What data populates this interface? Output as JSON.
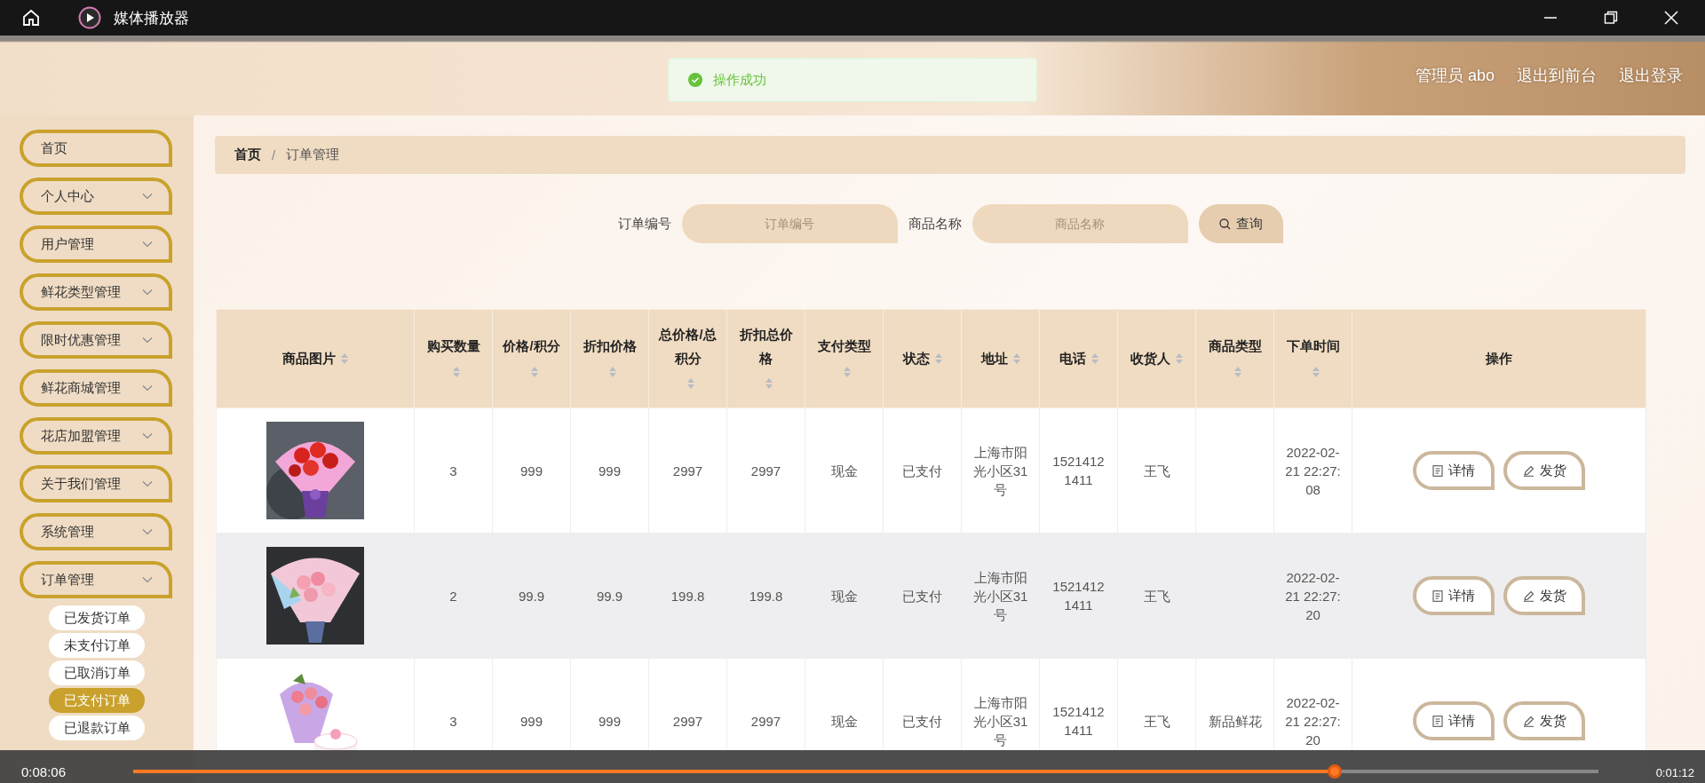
{
  "player": {
    "title": "媒体播放器",
    "elapsed": "0:08:06",
    "remaining": "0:01:12",
    "level": 0.82
  },
  "header": {
    "links": [
      "管理员 abo",
      "退出到前台",
      "退出登录"
    ]
  },
  "toast": {
    "text": "操作成功"
  },
  "sidebar": {
    "items": [
      {
        "label": "首页",
        "kind": "link"
      },
      {
        "label": "个人中心",
        "kind": "submenu"
      },
      {
        "label": "用户管理",
        "kind": "submenu"
      },
      {
        "label": "鲜花类型管理",
        "kind": "submenu"
      },
      {
        "label": "限时优惠管理",
        "kind": "submenu"
      },
      {
        "label": "鲜花商城管理",
        "kind": "submenu"
      },
      {
        "label": "花店加盟管理",
        "kind": "submenu"
      },
      {
        "label": "关于我们管理",
        "kind": "submenu"
      },
      {
        "label": "系统管理",
        "kind": "submenu"
      },
      {
        "label": "订单管理",
        "kind": "submenu",
        "children": [
          {
            "label": "已发货订单",
            "selected": false
          },
          {
            "label": "未支付订单",
            "selected": false
          },
          {
            "label": "已取消订单",
            "selected": false
          },
          {
            "label": "已支付订单",
            "selected": true
          },
          {
            "label": "已退款订单",
            "selected": false
          }
        ]
      }
    ]
  },
  "breadcrumb": {
    "items": [
      "首页",
      "订单管理"
    ],
    "separator": "/"
  },
  "search": {
    "fields": [
      {
        "label": "订单编号",
        "placeholder": "订单编号"
      },
      {
        "label": "商品名称",
        "placeholder": "商品名称"
      }
    ],
    "button": "查询"
  },
  "table": {
    "columns": [
      {
        "label": "商品图片",
        "sortable": true
      },
      {
        "label": "购买数量",
        "sortable": true
      },
      {
        "label": "价格/积分",
        "sortable": true
      },
      {
        "label": "折扣价格",
        "sortable": true
      },
      {
        "label": "总价格/总积分",
        "sortable": true
      },
      {
        "label": "折扣总价格",
        "sortable": true
      },
      {
        "label": "支付类型",
        "sortable": true
      },
      {
        "label": "状态",
        "sortable": true
      },
      {
        "label": "地址",
        "sortable": true
      },
      {
        "label": "电话",
        "sortable": true
      },
      {
        "label": "收货人",
        "sortable": true
      },
      {
        "label": "商品类型",
        "sortable": true
      },
      {
        "label": "下单时间",
        "sortable": true
      },
      {
        "label": "操作",
        "sortable": false
      }
    ],
    "rows": [
      {
        "highlighted": false,
        "cells": [
          {
            "kind": "picture"
          },
          "3",
          "999",
          "999",
          "2997",
          "2997",
          "现金",
          "已支付",
          "上海市阳光小区31号",
          "15214121411",
          "王飞",
          "",
          "2022-02-21 22:27:08",
          {
            "kind": "actions",
            "buttons": [
              "详情",
              "发货"
            ]
          }
        ]
      },
      {
        "highlighted": true,
        "cells": [
          {
            "kind": "picture"
          },
          "2",
          "99.9",
          "99.9",
          "199.8",
          "199.8",
          "现金",
          "已支付",
          "上海市阳光小区31号",
          "15214121411",
          "王飞",
          "",
          "2022-02-21 22:27:20",
          {
            "kind": "actions",
            "buttons": [
              "详情",
              "发货"
            ]
          }
        ]
      },
      {
        "highlighted": false,
        "cells": [
          {
            "kind": "picture"
          },
          "3",
          "999",
          "999",
          "2997",
          "2997",
          "现金",
          "已支付",
          "上海市阳光小区31号",
          "15214121411",
          "王飞",
          "新品鲜花",
          "2022-02-21 22:27:20",
          {
            "kind": "actions",
            "buttons": [
              "详情",
              "发货"
            ]
          }
        ]
      }
    ]
  }
}
